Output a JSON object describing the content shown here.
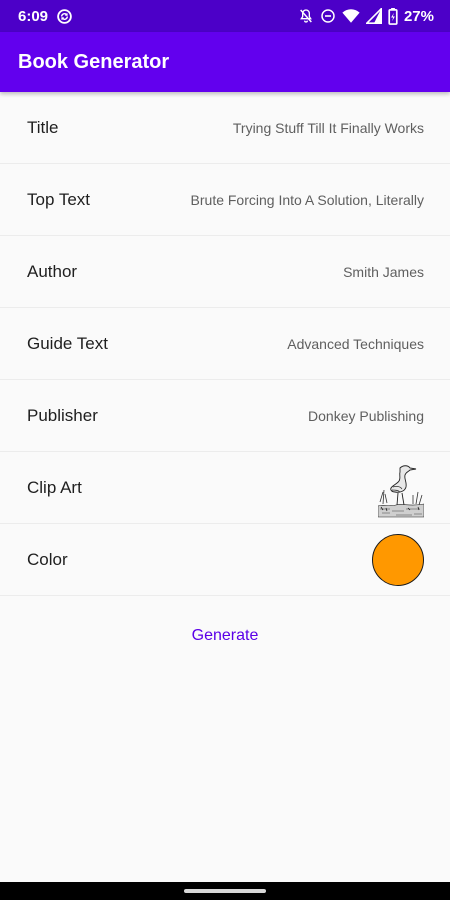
{
  "status_bar": {
    "time": "6:09",
    "battery": "27%",
    "icons": [
      "sync-icon",
      "notifications-off-icon",
      "do-not-disturb-icon",
      "wifi-icon",
      "signal-icon",
      "battery-charging-icon"
    ]
  },
  "app_bar": {
    "title": "Book Generator"
  },
  "fields": [
    {
      "label": "Title",
      "value": "Trying Stuff Till It Finally Works"
    },
    {
      "label": "Top Text",
      "value": "Brute Forcing Into A Solution, Literally"
    },
    {
      "label": "Author",
      "value": "Smith James"
    },
    {
      "label": "Guide Text",
      "value": "Advanced Techniques"
    },
    {
      "label": "Publisher",
      "value": "Donkey Publishing"
    },
    {
      "label": "Clip Art",
      "value_icon": "heron-clipart-icon"
    },
    {
      "label": "Color",
      "value_color": "#ff9800"
    }
  ],
  "actions": {
    "generate_label": "Generate"
  },
  "colors": {
    "status_bar": "#4c00c8",
    "app_bar": "#6200ee",
    "accent_text": "#5b00e8",
    "selected_color": "#ff9800"
  }
}
